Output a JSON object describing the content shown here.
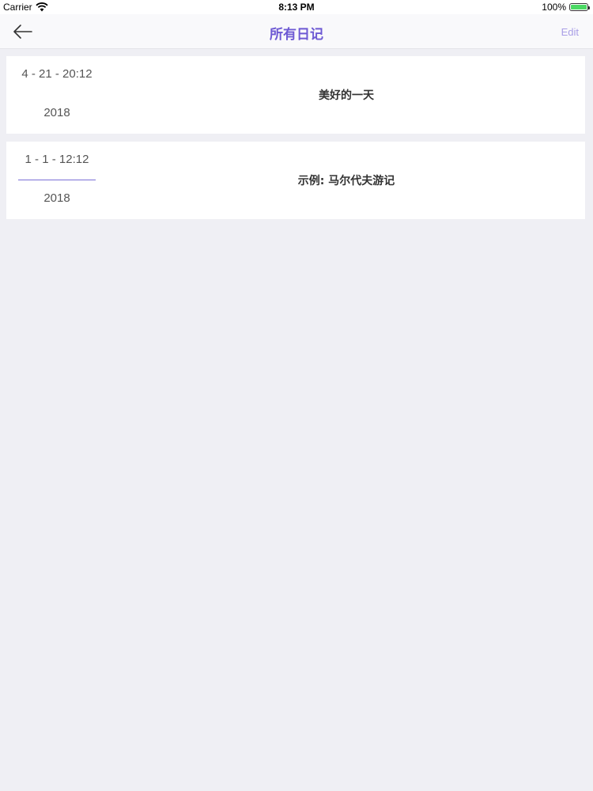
{
  "status_bar": {
    "carrier": "Carrier",
    "wifi_icon": "wifi-icon",
    "time": "8:13 PM",
    "battery_percent": "100%",
    "battery_icon": "battery-icon",
    "battery_level": 1.0
  },
  "nav": {
    "back_icon": "arrow-left-icon",
    "title": "所有日记",
    "edit_label": "Edit"
  },
  "diaries": [
    {
      "date": "4 - 21 - 20:12",
      "year": "2018",
      "title": "美好的一天"
    },
    {
      "date": "1 - 1 - 12:12",
      "year": "2018",
      "title": "示例: 马尔代夫游记"
    }
  ],
  "colors": {
    "accent": "#6e5ad4",
    "edit_color": "#a99fe6",
    "background": "#efeff4"
  }
}
